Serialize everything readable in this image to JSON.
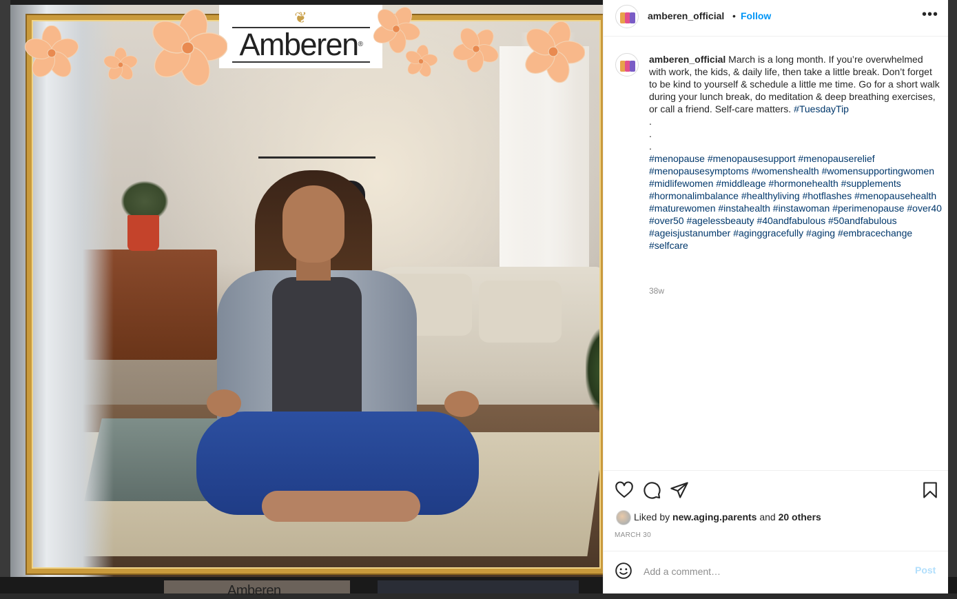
{
  "post": {
    "username": "amberen_official",
    "follow_label": "Follow",
    "more_label": "•••",
    "caption_text": "March is a long month. If you’re overwhelmed with work, the kids, & daily life, then take a little break. Don’t forget to be kind to yourself & schedule a little me time. Go for a short walk during your lunch break, do meditation & deep breathing exercises, or call a friend. Self-care matters.",
    "caption_first_tag": "#TuesdayTip",
    "caption_dots": [
      ".",
      ".",
      "."
    ],
    "hashtags": [
      "#menopause",
      "#menopausesupport",
      "#menopauserelief",
      "#menopausesymptoms",
      "#womenshealth",
      "#womensupportingwomen",
      "#midlifewomen",
      "#middleage",
      "#hormonehealth",
      "#supplements",
      "#hormonalimbalance",
      "#healthyliving",
      "#hotflashes",
      "#menopausehealth",
      "#maturewomen",
      "#instahealth",
      "#instawoman",
      "#perimenopause",
      "#over40",
      "#over50",
      "#agelessbeauty",
      "#40andfabulous",
      "#50andfabulous",
      "#ageisjustanumber",
      "#aginggracefully",
      "#aging",
      "#embracechange",
      "#selfcare"
    ],
    "caption_age": "38w",
    "likes_prefix": "Liked by",
    "likes_user": "new.aging.parents",
    "likes_and": "and",
    "likes_others": "20 others",
    "date": "MARCH 30"
  },
  "image": {
    "logo_text": "Amberen",
    "logo_registered": "®"
  },
  "comment": {
    "placeholder": "Add a comment…",
    "post_label": "Post"
  },
  "background_feed": {
    "thumb_logo_text": "Amberen"
  },
  "icons": {
    "like": "heart-icon",
    "comment": "comment-bubble-icon",
    "share": "paper-plane-icon",
    "save": "bookmark-icon",
    "emoji": "smiley-face-icon",
    "more": "ellipsis-icon"
  },
  "colors": {
    "link_blue": "#0095f6",
    "hashtag_blue": "#00376b",
    "post_button_disabled": "#b2dffc",
    "frame_gold": "#c99a3c",
    "flower_peach": "#f8b88a"
  }
}
